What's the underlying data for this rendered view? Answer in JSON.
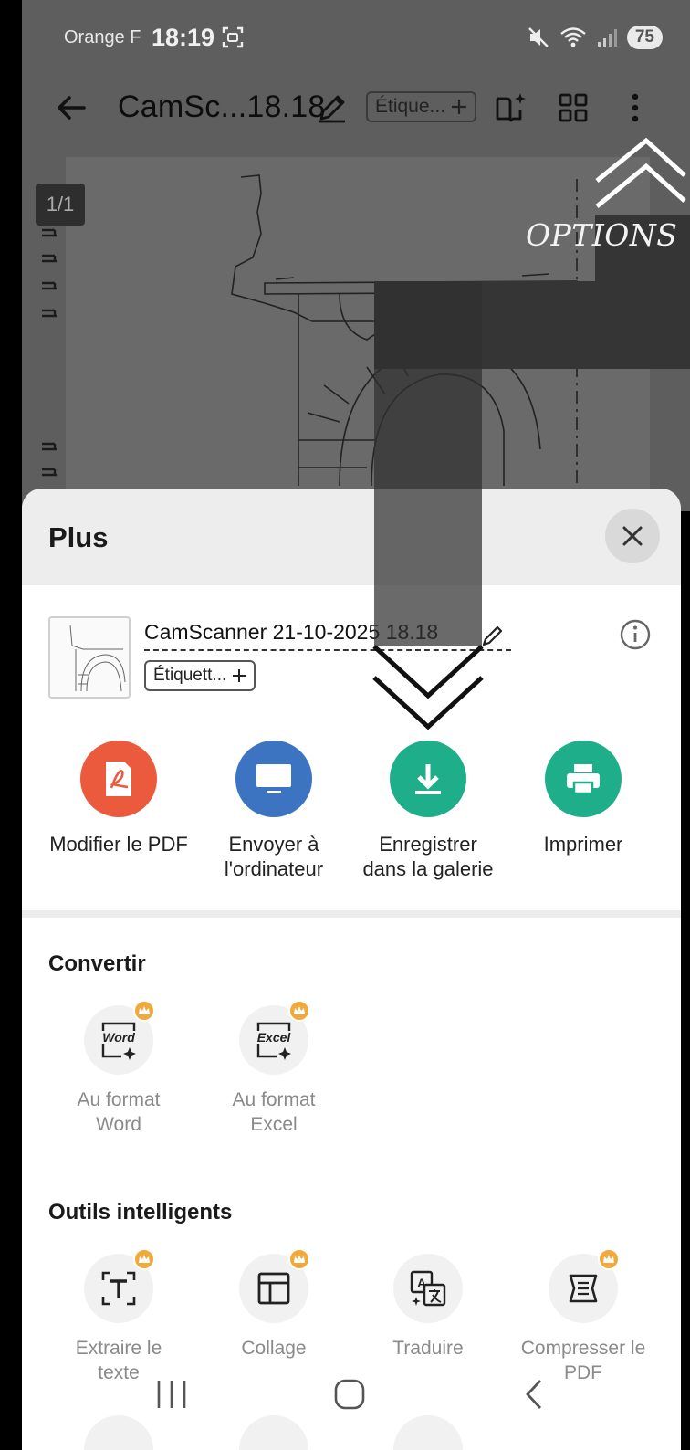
{
  "status_bar": {
    "carrier": "Orange F",
    "time": "18:19",
    "battery": "75"
  },
  "toolbar": {
    "title": "CamSc...18.18",
    "tag_label": "Étique...",
    "icons": [
      "back-arrow-icon",
      "edit-pencil-icon",
      "add-tag-icon",
      "book-sparkle-icon",
      "grid-view-icon",
      "more-vert-icon"
    ]
  },
  "preview": {
    "page_indicator": "1/1"
  },
  "tutorial": {
    "options_label": "OPTIONS"
  },
  "sheet": {
    "title": "Plus",
    "file": {
      "name": "CamScanner 21-10-2025 18.18",
      "tag_label": "Étiquett..."
    },
    "actions": [
      {
        "label_line1": "Modifier le PDF",
        "label_line2": "",
        "color": "#eb5a3c",
        "icon": "pdf-icon"
      },
      {
        "label_line1": "Envoyer à",
        "label_line2": "l'ordinateur",
        "color": "#3d74c2",
        "icon": "monitor-icon"
      },
      {
        "label_line1": "Enregistrer",
        "label_line2": "dans la galerie",
        "color": "#1fae8a",
        "icon": "download-icon"
      },
      {
        "label_line1": "Imprimer",
        "label_line2": "",
        "color": "#1fae8a",
        "icon": "printer-icon"
      }
    ],
    "convert": {
      "title": "Convertir",
      "items": [
        {
          "label_line1": "Au format",
          "label_line2": "Word",
          "icon_text": "Word"
        },
        {
          "label_line1": "Au format",
          "label_line2": "Excel",
          "icon_text": "Excel"
        }
      ]
    },
    "smart_tools": {
      "title": "Outils intelligents",
      "items": [
        {
          "label_line1": "Extraire le",
          "label_line2": "texte",
          "icon": "extract-text-icon"
        },
        {
          "label_line1": "Collage",
          "label_line2": "",
          "icon": "collage-icon"
        },
        {
          "label_line1": "Traduire",
          "label_line2": "",
          "icon": "translate-icon"
        },
        {
          "label_line1": "Compresser le",
          "label_line2": "PDF",
          "icon": "compress-pdf-icon"
        }
      ]
    }
  }
}
